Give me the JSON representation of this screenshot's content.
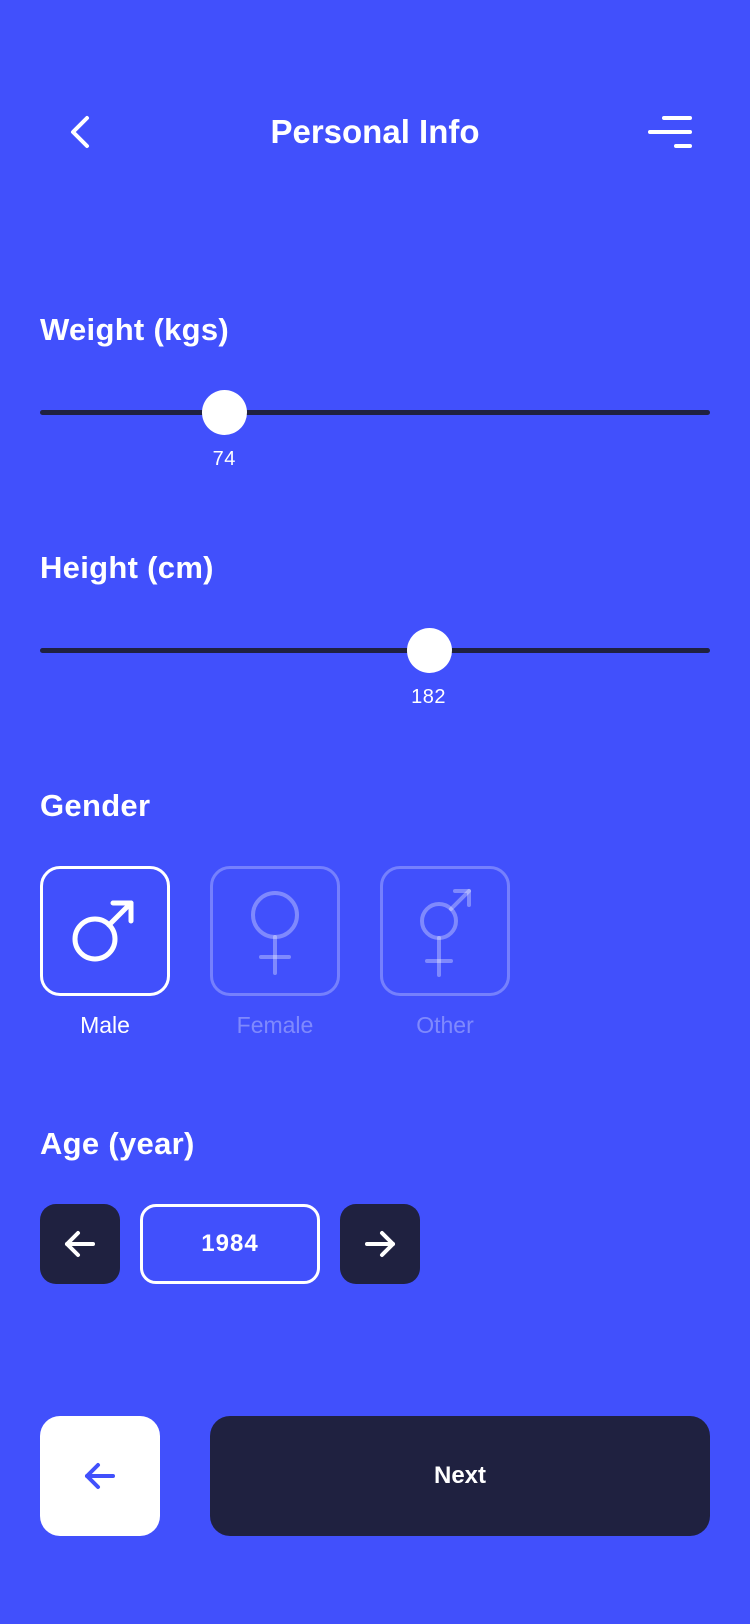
{
  "header": {
    "title": "Personal Info",
    "back_icon": "chevron-left-icon",
    "menu_icon": "menu-icon"
  },
  "weight": {
    "label": "Weight (kgs)",
    "value": "74",
    "fraction": 0.275
  },
  "height": {
    "label": "Height (cm)",
    "value": "182",
    "fraction": 0.58
  },
  "gender": {
    "label": "Gender",
    "options": [
      {
        "label": "Male",
        "icon": "male-icon",
        "selected": true
      },
      {
        "label": "Female",
        "icon": "female-icon",
        "selected": false
      },
      {
        "label": "Other",
        "icon": "transgender-icon",
        "selected": false
      }
    ]
  },
  "age": {
    "label": "Age (year)",
    "value": "1984",
    "prev_icon": "arrow-left-icon",
    "next_icon": "arrow-right-icon"
  },
  "footer": {
    "back_icon": "arrow-left-icon",
    "next_label": "Next"
  },
  "colors": {
    "background": "#4150fc",
    "dark": "#1f2140",
    "white": "#ffffff"
  }
}
